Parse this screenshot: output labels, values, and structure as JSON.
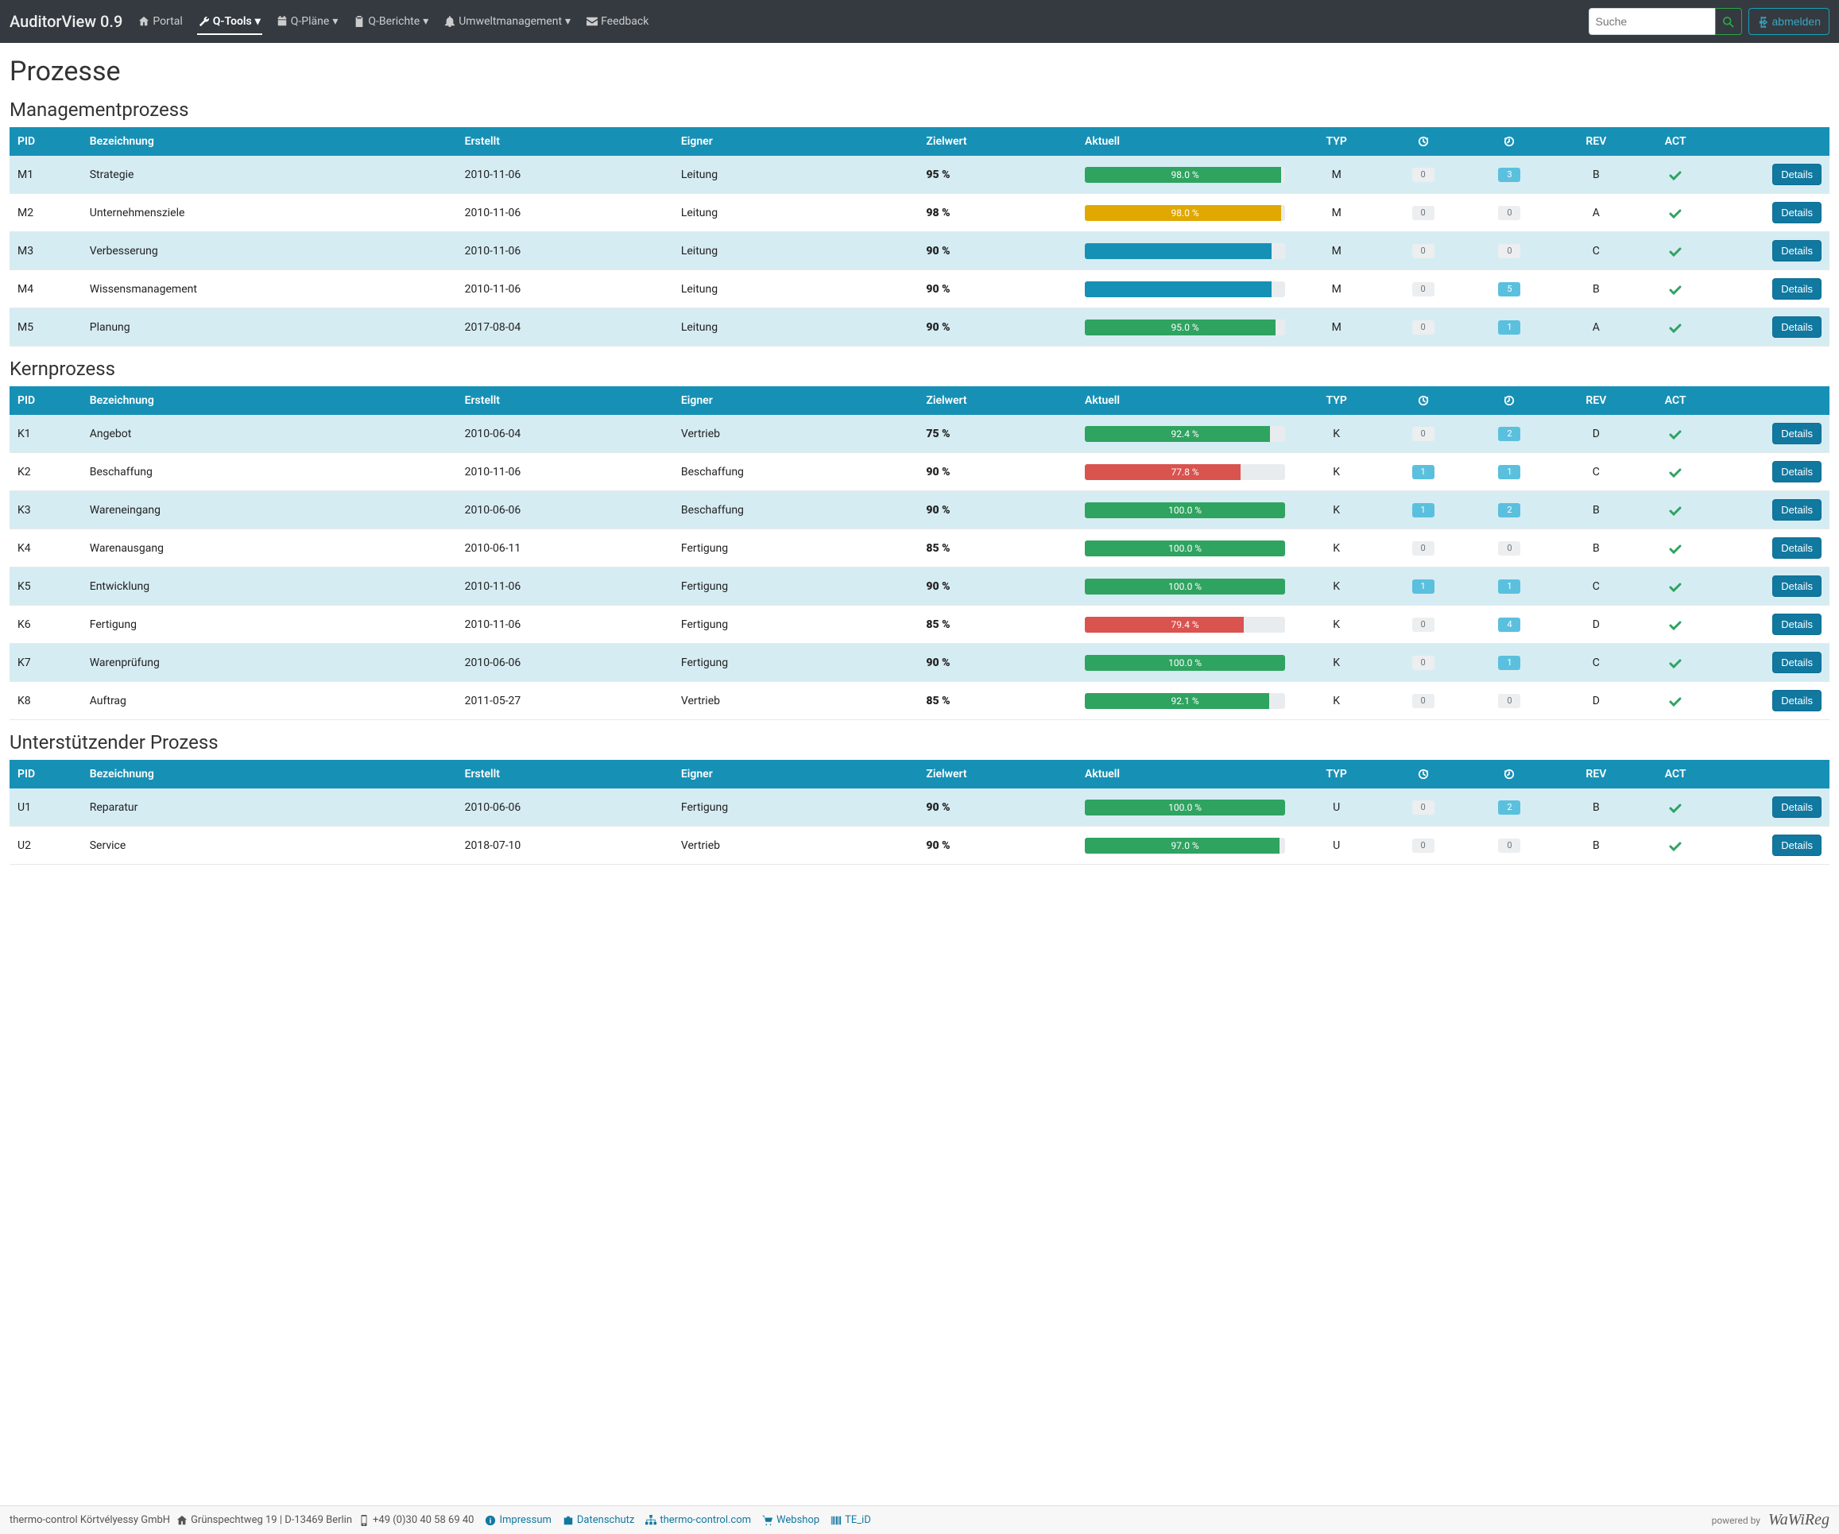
{
  "brand": "AuditorView 0.9",
  "nav": {
    "portal": "Portal",
    "qtools": "Q-Tools",
    "qplane": "Q-Pläne",
    "qberichte": "Q-Berichte",
    "umwelt": "Umweltmanagement",
    "feedback": "Feedback"
  },
  "search_placeholder": "Suche",
  "logout": "abmelden",
  "page_title": "Prozesse",
  "columns": {
    "pid": "PID",
    "bez": "Bezeichnung",
    "erstellt": "Erstellt",
    "eigner": "Eigner",
    "ziel": "Zielwert",
    "aktuell": "Aktuell",
    "typ": "TYP",
    "rev": "REV",
    "act": "ACT"
  },
  "details_label": "Details",
  "sections": [
    {
      "title": "Managementprozess",
      "rows": [
        {
          "pid": "M1",
          "bez": "Strategie",
          "date": "2010-11-06",
          "owner": "Leitung",
          "target": "95 %",
          "pct": 98.0,
          "label": "98.0 %",
          "color": "green",
          "typ": "M",
          "b1": {
            "n": "0",
            "c": "gray"
          },
          "b2": {
            "n": "3",
            "c": "blue"
          },
          "rev": "B",
          "act": true
        },
        {
          "pid": "M2",
          "bez": "Unternehmensziele",
          "date": "2010-11-06",
          "owner": "Leitung",
          "target": "98 %",
          "pct": 98.0,
          "label": "98.0 %",
          "color": "orange",
          "typ": "M",
          "b1": {
            "n": "0",
            "c": "gray"
          },
          "b2": {
            "n": "0",
            "c": "gray"
          },
          "rev": "A",
          "act": true
        },
        {
          "pid": "M3",
          "bez": "Verbesserung",
          "date": "2010-11-06",
          "owner": "Leitung",
          "target": "90 %",
          "pct": 93,
          "label": "",
          "color": "blue",
          "typ": "M",
          "b1": {
            "n": "0",
            "c": "gray"
          },
          "b2": {
            "n": "0",
            "c": "gray"
          },
          "rev": "C",
          "act": true
        },
        {
          "pid": "M4",
          "bez": "Wissensmanagement",
          "date": "2010-11-06",
          "owner": "Leitung",
          "target": "90 %",
          "pct": 93,
          "label": "",
          "color": "blue",
          "typ": "M",
          "b1": {
            "n": "0",
            "c": "gray"
          },
          "b2": {
            "n": "5",
            "c": "blue"
          },
          "rev": "B",
          "act": true
        },
        {
          "pid": "M5",
          "bez": "Planung",
          "date": "2017-08-04",
          "owner": "Leitung",
          "target": "90 %",
          "pct": 95.0,
          "label": "95.0 %",
          "color": "green",
          "typ": "M",
          "b1": {
            "n": "0",
            "c": "gray"
          },
          "b2": {
            "n": "1",
            "c": "blue"
          },
          "rev": "A",
          "act": true
        }
      ]
    },
    {
      "title": "Kernprozess",
      "rows": [
        {
          "pid": "K1",
          "bez": "Angebot",
          "date": "2010-06-04",
          "owner": "Vertrieb",
          "target": "75 %",
          "pct": 92.4,
          "label": "92.4 %",
          "color": "green",
          "typ": "K",
          "b1": {
            "n": "0",
            "c": "gray"
          },
          "b2": {
            "n": "2",
            "c": "blue"
          },
          "rev": "D",
          "act": true
        },
        {
          "pid": "K2",
          "bez": "Beschaffung",
          "date": "2010-11-06",
          "owner": "Beschaffung",
          "target": "90 %",
          "pct": 77.8,
          "label": "77.8 %",
          "color": "red",
          "typ": "K",
          "b1": {
            "n": "1",
            "c": "blue"
          },
          "b2": {
            "n": "1",
            "c": "blue"
          },
          "rev": "C",
          "act": true
        },
        {
          "pid": "K3",
          "bez": "Wareneingang",
          "date": "2010-06-06",
          "owner": "Beschaffung",
          "target": "90 %",
          "pct": 100.0,
          "label": "100.0 %",
          "color": "green",
          "typ": "K",
          "b1": {
            "n": "1",
            "c": "blue"
          },
          "b2": {
            "n": "2",
            "c": "blue"
          },
          "rev": "B",
          "act": true
        },
        {
          "pid": "K4",
          "bez": "Warenausgang",
          "date": "2010-06-11",
          "owner": "Fertigung",
          "target": "85 %",
          "pct": 100.0,
          "label": "100.0 %",
          "color": "green",
          "typ": "K",
          "b1": {
            "n": "0",
            "c": "gray"
          },
          "b2": {
            "n": "0",
            "c": "gray"
          },
          "rev": "B",
          "act": true
        },
        {
          "pid": "K5",
          "bez": "Entwicklung",
          "date": "2010-11-06",
          "owner": "Fertigung",
          "target": "90 %",
          "pct": 100.0,
          "label": "100.0 %",
          "color": "green",
          "typ": "K",
          "b1": {
            "n": "1",
            "c": "blue"
          },
          "b2": {
            "n": "1",
            "c": "blue"
          },
          "rev": "C",
          "act": true
        },
        {
          "pid": "K6",
          "bez": "Fertigung",
          "date": "2010-11-06",
          "owner": "Fertigung",
          "target": "85 %",
          "pct": 79.4,
          "label": "79.4 %",
          "color": "red",
          "typ": "K",
          "b1": {
            "n": "0",
            "c": "gray"
          },
          "b2": {
            "n": "4",
            "c": "blue"
          },
          "rev": "D",
          "act": true
        },
        {
          "pid": "K7",
          "bez": "Warenprüfung",
          "date": "2010-06-06",
          "owner": "Fertigung",
          "target": "90 %",
          "pct": 100.0,
          "label": "100.0 %",
          "color": "green",
          "typ": "K",
          "b1": {
            "n": "0",
            "c": "gray"
          },
          "b2": {
            "n": "1",
            "c": "blue"
          },
          "rev": "C",
          "act": true
        },
        {
          "pid": "K8",
          "bez": "Auftrag",
          "date": "2011-05-27",
          "owner": "Vertrieb",
          "target": "85 %",
          "pct": 92.1,
          "label": "92.1 %",
          "color": "green",
          "typ": "K",
          "b1": {
            "n": "0",
            "c": "gray"
          },
          "b2": {
            "n": "0",
            "c": "gray"
          },
          "rev": "D",
          "act": true
        }
      ]
    },
    {
      "title": "Unterstützender Prozess",
      "rows": [
        {
          "pid": "U1",
          "bez": "Reparatur",
          "date": "2010-06-06",
          "owner": "Fertigung",
          "target": "90 %",
          "pct": 100.0,
          "label": "100.0 %",
          "color": "green",
          "typ": "U",
          "b1": {
            "n": "0",
            "c": "gray"
          },
          "b2": {
            "n": "2",
            "c": "blue"
          },
          "rev": "B",
          "act": true
        },
        {
          "pid": "U2",
          "bez": "Service",
          "date": "2018-07-10",
          "owner": "Vertrieb",
          "target": "90 %",
          "pct": 97.0,
          "label": "97.0 %",
          "color": "green",
          "typ": "U",
          "b1": {
            "n": "0",
            "c": "gray"
          },
          "b2": {
            "n": "0",
            "c": "gray"
          },
          "rev": "B",
          "act": true
        }
      ]
    }
  ],
  "footer": {
    "company": "thermo-control Körtvélyessy GmbH",
    "address": "Grünspechtweg 19 | D-13469 Berlin",
    "phone": "+49 (0)30 40 58 69 40",
    "links": {
      "impressum": "Impressum",
      "datenschutz": "Datenschutz",
      "thermo": "thermo-control.com",
      "webshop": "Webshop",
      "teid": "TE_iD"
    },
    "powered": "powered by",
    "logo": "WaWiReg"
  }
}
